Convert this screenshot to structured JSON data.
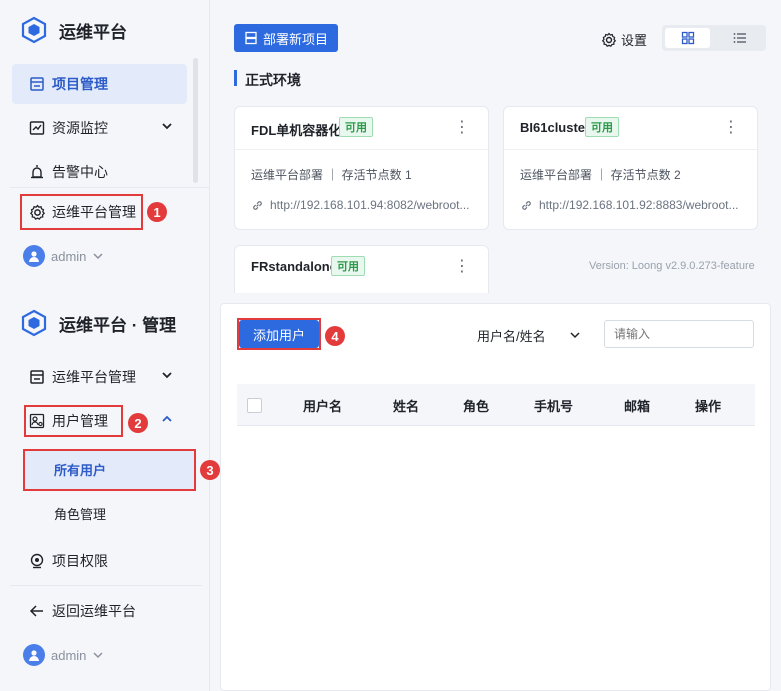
{
  "top": {
    "app_title": "运维平台",
    "nav": {
      "project_mgmt": "项目管理",
      "resource_monitor": "资源监控",
      "alert_center": "告警中心",
      "platform_mgmt": "运维平台管理"
    },
    "user": "admin",
    "deploy_button": "部署新项目",
    "settings": "设置",
    "env_title": "正式环境",
    "cards": [
      {
        "title": "FDL单机容器化",
        "status": "可用",
        "info": "运维平台部署 ｜ 存活节点数 1",
        "url": "http://192.168.101.94:8082/webroot..."
      },
      {
        "title": "BI61cluster",
        "status": "可用",
        "info": "运维平台部署 ｜ 存活节点数 2",
        "url": "http://192.168.101.92:8883/webroot..."
      },
      {
        "title": "FRstandalone",
        "status": "可用"
      }
    ],
    "version": "Version: Loong v2.9.0.273-feature"
  },
  "bottom": {
    "app_title": "运维平台 · 管理",
    "nav": {
      "platform_mgmt": "运维平台管理",
      "user_mgmt": "用户管理",
      "all_users": "所有用户",
      "role_mgmt": "角色管理",
      "project_perm": "项目权限",
      "back": "返回运维平台"
    },
    "user": "admin",
    "add_user_button": "添加用户",
    "filter_select": "用户名/姓名",
    "search_placeholder": "请输入",
    "table_headers": [
      "用户名",
      "姓名",
      "角色",
      "手机号",
      "邮箱",
      "操作"
    ]
  },
  "badges": [
    "1",
    "2",
    "3",
    "4"
  ],
  "colors": {
    "primary": "#2d6ae0",
    "highlight": "#e33b3b",
    "active_bg": "#e3ebfa",
    "available": "#2b9a4a"
  }
}
